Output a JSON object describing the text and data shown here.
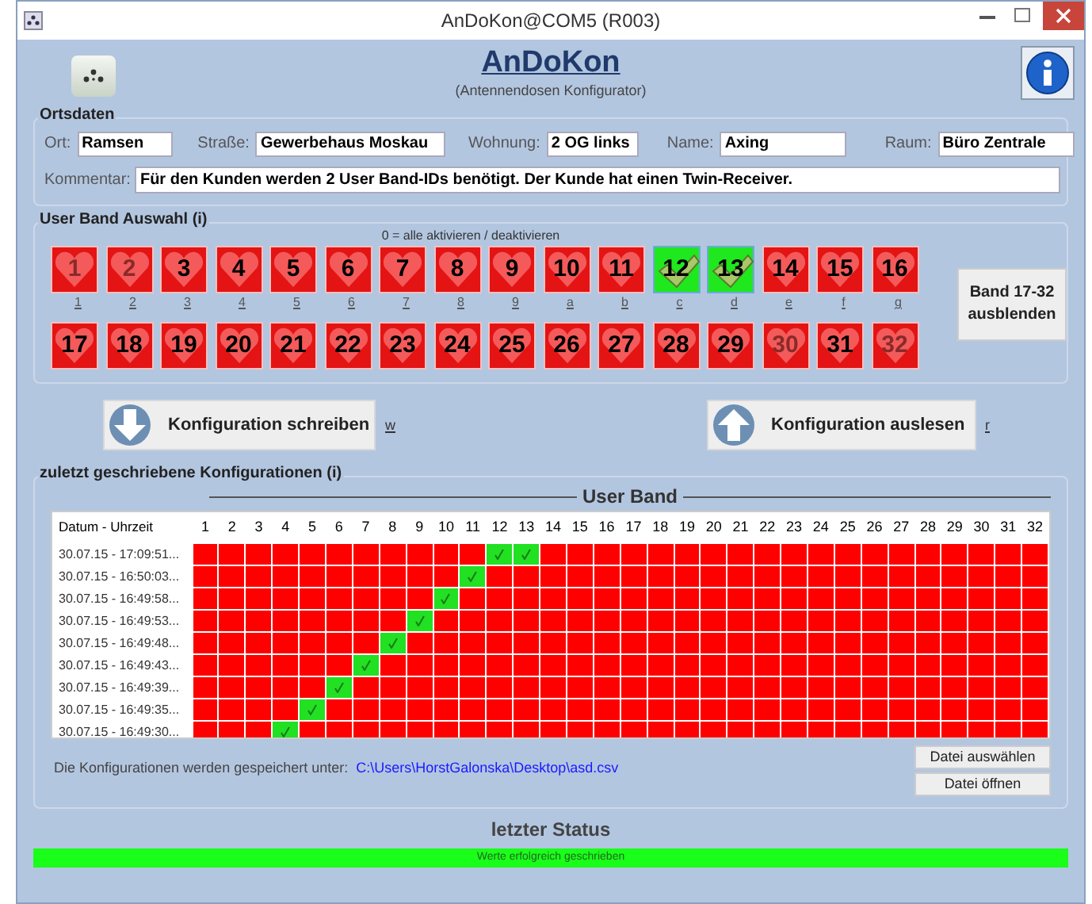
{
  "window": {
    "title": "AnDoKon@COM5 (R003)"
  },
  "header": {
    "title": "AnDoKon",
    "subtitle": "(Antennendosen Konfigurator)"
  },
  "ortsdaten": {
    "legend": "Ortsdaten",
    "fields": [
      {
        "label": "Ort:",
        "value": "Ramsen"
      },
      {
        "label": "Straße:",
        "value": "Gewerbehaus Moskau"
      },
      {
        "label": "Wohnung:",
        "value": "2 OG links"
      },
      {
        "label": "Name:",
        "value": "Axing"
      },
      {
        "label": "Raum:",
        "value": "Büro Zentrale"
      }
    ],
    "comment": {
      "label": "Kommentar:",
      "value": "Für den Kunden werden 2 User Band-IDs benötigt. Der Kunde hat einen Twin-Receiver."
    }
  },
  "user_band": {
    "legend": "User Band Auswahl (i)",
    "hint": "0 = alle aktivieren / deaktivieren",
    "bands": [
      {
        "label": "1",
        "selected": false,
        "dimmed": true,
        "shortcut": "1"
      },
      {
        "label": "2",
        "selected": false,
        "dimmed": true,
        "shortcut": "2"
      },
      {
        "label": "3",
        "selected": false,
        "dimmed": false,
        "shortcut": "3"
      },
      {
        "label": "4",
        "selected": false,
        "dimmed": false,
        "shortcut": "4"
      },
      {
        "label": "5",
        "selected": false,
        "dimmed": false,
        "shortcut": "5"
      },
      {
        "label": "6",
        "selected": false,
        "dimmed": false,
        "shortcut": "6"
      },
      {
        "label": "7",
        "selected": false,
        "dimmed": false,
        "shortcut": "7"
      },
      {
        "label": "8",
        "selected": false,
        "dimmed": false,
        "shortcut": "8"
      },
      {
        "label": "9",
        "selected": false,
        "dimmed": false,
        "shortcut": "9"
      },
      {
        "label": "10",
        "selected": false,
        "dimmed": false,
        "shortcut": "a"
      },
      {
        "label": "11",
        "selected": false,
        "dimmed": false,
        "shortcut": "b"
      },
      {
        "label": "12",
        "selected": true,
        "dimmed": false,
        "shortcut": "c"
      },
      {
        "label": "13",
        "selected": true,
        "dimmed": false,
        "shortcut": "d"
      },
      {
        "label": "14",
        "selected": false,
        "dimmed": false,
        "shortcut": "e"
      },
      {
        "label": "15",
        "selected": false,
        "dimmed": false,
        "shortcut": "f"
      },
      {
        "label": "16",
        "selected": false,
        "dimmed": false,
        "shortcut": "g"
      },
      {
        "label": "17",
        "selected": false,
        "dimmed": false
      },
      {
        "label": "18",
        "selected": false,
        "dimmed": false
      },
      {
        "label": "19",
        "selected": false,
        "dimmed": false
      },
      {
        "label": "20",
        "selected": false,
        "dimmed": false
      },
      {
        "label": "21",
        "selected": false,
        "dimmed": false
      },
      {
        "label": "22",
        "selected": false,
        "dimmed": false
      },
      {
        "label": "23",
        "selected": false,
        "dimmed": false
      },
      {
        "label": "24",
        "selected": false,
        "dimmed": false
      },
      {
        "label": "25",
        "selected": false,
        "dimmed": false
      },
      {
        "label": "26",
        "selected": false,
        "dimmed": false
      },
      {
        "label": "27",
        "selected": false,
        "dimmed": false
      },
      {
        "label": "28",
        "selected": false,
        "dimmed": false
      },
      {
        "label": "29",
        "selected": false,
        "dimmed": false
      },
      {
        "label": "30",
        "selected": false,
        "dimmed": true
      },
      {
        "label": "31",
        "selected": false,
        "dimmed": false
      },
      {
        "label": "32",
        "selected": false,
        "dimmed": true
      }
    ],
    "hide_button": "Band 17-32 ausblenden"
  },
  "actions": [
    {
      "kind": "write",
      "label": "Konfiguration schreiben",
      "shortcut": "w"
    },
    {
      "kind": "read",
      "label": "Konfiguration auslesen",
      "shortcut": "r"
    }
  ],
  "history": {
    "legend": "zuletzt geschriebene Konfigurationen (i)",
    "group_label": "User Band",
    "date_column": "Datum - Uhrzeit",
    "columns": [
      "1",
      "2",
      "3",
      "4",
      "5",
      "6",
      "7",
      "8",
      "9",
      "10",
      "11",
      "12",
      "13",
      "14",
      "15",
      "16",
      "17",
      "18",
      "19",
      "20",
      "21",
      "22",
      "23",
      "24",
      "25",
      "26",
      "27",
      "28",
      "29",
      "30",
      "31",
      "32"
    ],
    "rows": [
      {
        "time": "30.07.15 - 17:09:51...",
        "checked": [
          false,
          false,
          false,
          false,
          false,
          false,
          false,
          false,
          false,
          false,
          false,
          true,
          true,
          false,
          false,
          false,
          false,
          false,
          false,
          false,
          false,
          false,
          false,
          false,
          false,
          false,
          false,
          false,
          false,
          false,
          false,
          false
        ]
      },
      {
        "time": "30.07.15 - 16:50:03...",
        "checked": [
          false,
          false,
          false,
          false,
          false,
          false,
          false,
          false,
          false,
          false,
          true,
          false,
          false,
          false,
          false,
          false,
          false,
          false,
          false,
          false,
          false,
          false,
          false,
          false,
          false,
          false,
          false,
          false,
          false,
          false,
          false,
          false
        ]
      },
      {
        "time": "30.07.15 - 16:49:58...",
        "checked": [
          false,
          false,
          false,
          false,
          false,
          false,
          false,
          false,
          false,
          true,
          false,
          false,
          false,
          false,
          false,
          false,
          false,
          false,
          false,
          false,
          false,
          false,
          false,
          false,
          false,
          false,
          false,
          false,
          false,
          false,
          false,
          false
        ]
      },
      {
        "time": "30.07.15 - 16:49:53...",
        "checked": [
          false,
          false,
          false,
          false,
          false,
          false,
          false,
          false,
          true,
          false,
          false,
          false,
          false,
          false,
          false,
          false,
          false,
          false,
          false,
          false,
          false,
          false,
          false,
          false,
          false,
          false,
          false,
          false,
          false,
          false,
          false,
          false
        ]
      },
      {
        "time": "30.07.15 - 16:49:48...",
        "checked": [
          false,
          false,
          false,
          false,
          false,
          false,
          false,
          true,
          false,
          false,
          false,
          false,
          false,
          false,
          false,
          false,
          false,
          false,
          false,
          false,
          false,
          false,
          false,
          false,
          false,
          false,
          false,
          false,
          false,
          false,
          false,
          false
        ]
      },
      {
        "time": "30.07.15 - 16:49:43...",
        "checked": [
          false,
          false,
          false,
          false,
          false,
          false,
          true,
          false,
          false,
          false,
          false,
          false,
          false,
          false,
          false,
          false,
          false,
          false,
          false,
          false,
          false,
          false,
          false,
          false,
          false,
          false,
          false,
          false,
          false,
          false,
          false,
          false
        ]
      },
      {
        "time": "30.07.15 - 16:49:39...",
        "checked": [
          false,
          false,
          false,
          false,
          false,
          true,
          false,
          false,
          false,
          false,
          false,
          false,
          false,
          false,
          false,
          false,
          false,
          false,
          false,
          false,
          false,
          false,
          false,
          false,
          false,
          false,
          false,
          false,
          false,
          false,
          false,
          false
        ]
      },
      {
        "time": "30.07.15 - 16:49:35...",
        "checked": [
          false,
          false,
          false,
          false,
          true,
          false,
          false,
          false,
          false,
          false,
          false,
          false,
          false,
          false,
          false,
          false,
          false,
          false,
          false,
          false,
          false,
          false,
          false,
          false,
          false,
          false,
          false,
          false,
          false,
          false,
          false,
          false
        ]
      },
      {
        "time": "30.07.15 - 16:49:30...",
        "checked": [
          false,
          false,
          false,
          true,
          false,
          false,
          false,
          false,
          false,
          false,
          false,
          false,
          false,
          false,
          false,
          false,
          false,
          false,
          false,
          false,
          false,
          false,
          false,
          false,
          false,
          false,
          false,
          false,
          false,
          false,
          false,
          false
        ]
      }
    ],
    "save_label": "Die Konfigurationen werden gespeichert unter:",
    "save_path": "C:\\Users\\HorstGalonska\\Desktop\\asd.csv",
    "buttons": [
      "Datei auswählen",
      "Datei öffnen"
    ]
  },
  "status": {
    "title": "letzter Status",
    "message": "Werte erfolgreich geschrieben",
    "level": 1
  }
}
